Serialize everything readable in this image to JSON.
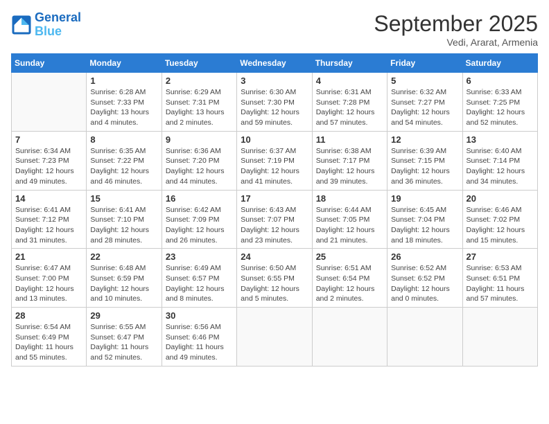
{
  "header": {
    "logo_line1": "General",
    "logo_line2": "Blue",
    "month": "September 2025",
    "location": "Vedi, Ararat, Armenia"
  },
  "weekdays": [
    "Sunday",
    "Monday",
    "Tuesday",
    "Wednesday",
    "Thursday",
    "Friday",
    "Saturday"
  ],
  "weeks": [
    [
      {
        "day": "",
        "detail": ""
      },
      {
        "day": "1",
        "detail": "Sunrise: 6:28 AM\nSunset: 7:33 PM\nDaylight: 13 hours\nand 4 minutes."
      },
      {
        "day": "2",
        "detail": "Sunrise: 6:29 AM\nSunset: 7:31 PM\nDaylight: 13 hours\nand 2 minutes."
      },
      {
        "day": "3",
        "detail": "Sunrise: 6:30 AM\nSunset: 7:30 PM\nDaylight: 12 hours\nand 59 minutes."
      },
      {
        "day": "4",
        "detail": "Sunrise: 6:31 AM\nSunset: 7:28 PM\nDaylight: 12 hours\nand 57 minutes."
      },
      {
        "day": "5",
        "detail": "Sunrise: 6:32 AM\nSunset: 7:27 PM\nDaylight: 12 hours\nand 54 minutes."
      },
      {
        "day": "6",
        "detail": "Sunrise: 6:33 AM\nSunset: 7:25 PM\nDaylight: 12 hours\nand 52 minutes."
      }
    ],
    [
      {
        "day": "7",
        "detail": "Sunrise: 6:34 AM\nSunset: 7:23 PM\nDaylight: 12 hours\nand 49 minutes."
      },
      {
        "day": "8",
        "detail": "Sunrise: 6:35 AM\nSunset: 7:22 PM\nDaylight: 12 hours\nand 46 minutes."
      },
      {
        "day": "9",
        "detail": "Sunrise: 6:36 AM\nSunset: 7:20 PM\nDaylight: 12 hours\nand 44 minutes."
      },
      {
        "day": "10",
        "detail": "Sunrise: 6:37 AM\nSunset: 7:19 PM\nDaylight: 12 hours\nand 41 minutes."
      },
      {
        "day": "11",
        "detail": "Sunrise: 6:38 AM\nSunset: 7:17 PM\nDaylight: 12 hours\nand 39 minutes."
      },
      {
        "day": "12",
        "detail": "Sunrise: 6:39 AM\nSunset: 7:15 PM\nDaylight: 12 hours\nand 36 minutes."
      },
      {
        "day": "13",
        "detail": "Sunrise: 6:40 AM\nSunset: 7:14 PM\nDaylight: 12 hours\nand 34 minutes."
      }
    ],
    [
      {
        "day": "14",
        "detail": "Sunrise: 6:41 AM\nSunset: 7:12 PM\nDaylight: 12 hours\nand 31 minutes."
      },
      {
        "day": "15",
        "detail": "Sunrise: 6:41 AM\nSunset: 7:10 PM\nDaylight: 12 hours\nand 28 minutes."
      },
      {
        "day": "16",
        "detail": "Sunrise: 6:42 AM\nSunset: 7:09 PM\nDaylight: 12 hours\nand 26 minutes."
      },
      {
        "day": "17",
        "detail": "Sunrise: 6:43 AM\nSunset: 7:07 PM\nDaylight: 12 hours\nand 23 minutes."
      },
      {
        "day": "18",
        "detail": "Sunrise: 6:44 AM\nSunset: 7:05 PM\nDaylight: 12 hours\nand 21 minutes."
      },
      {
        "day": "19",
        "detail": "Sunrise: 6:45 AM\nSunset: 7:04 PM\nDaylight: 12 hours\nand 18 minutes."
      },
      {
        "day": "20",
        "detail": "Sunrise: 6:46 AM\nSunset: 7:02 PM\nDaylight: 12 hours\nand 15 minutes."
      }
    ],
    [
      {
        "day": "21",
        "detail": "Sunrise: 6:47 AM\nSunset: 7:00 PM\nDaylight: 12 hours\nand 13 minutes."
      },
      {
        "day": "22",
        "detail": "Sunrise: 6:48 AM\nSunset: 6:59 PM\nDaylight: 12 hours\nand 10 minutes."
      },
      {
        "day": "23",
        "detail": "Sunrise: 6:49 AM\nSunset: 6:57 PM\nDaylight: 12 hours\nand 8 minutes."
      },
      {
        "day": "24",
        "detail": "Sunrise: 6:50 AM\nSunset: 6:55 PM\nDaylight: 12 hours\nand 5 minutes."
      },
      {
        "day": "25",
        "detail": "Sunrise: 6:51 AM\nSunset: 6:54 PM\nDaylight: 12 hours\nand 2 minutes."
      },
      {
        "day": "26",
        "detail": "Sunrise: 6:52 AM\nSunset: 6:52 PM\nDaylight: 12 hours\nand 0 minutes."
      },
      {
        "day": "27",
        "detail": "Sunrise: 6:53 AM\nSunset: 6:51 PM\nDaylight: 11 hours\nand 57 minutes."
      }
    ],
    [
      {
        "day": "28",
        "detail": "Sunrise: 6:54 AM\nSunset: 6:49 PM\nDaylight: 11 hours\nand 55 minutes."
      },
      {
        "day": "29",
        "detail": "Sunrise: 6:55 AM\nSunset: 6:47 PM\nDaylight: 11 hours\nand 52 minutes."
      },
      {
        "day": "30",
        "detail": "Sunrise: 6:56 AM\nSunset: 6:46 PM\nDaylight: 11 hours\nand 49 minutes."
      },
      {
        "day": "",
        "detail": ""
      },
      {
        "day": "",
        "detail": ""
      },
      {
        "day": "",
        "detail": ""
      },
      {
        "day": "",
        "detail": ""
      }
    ]
  ]
}
